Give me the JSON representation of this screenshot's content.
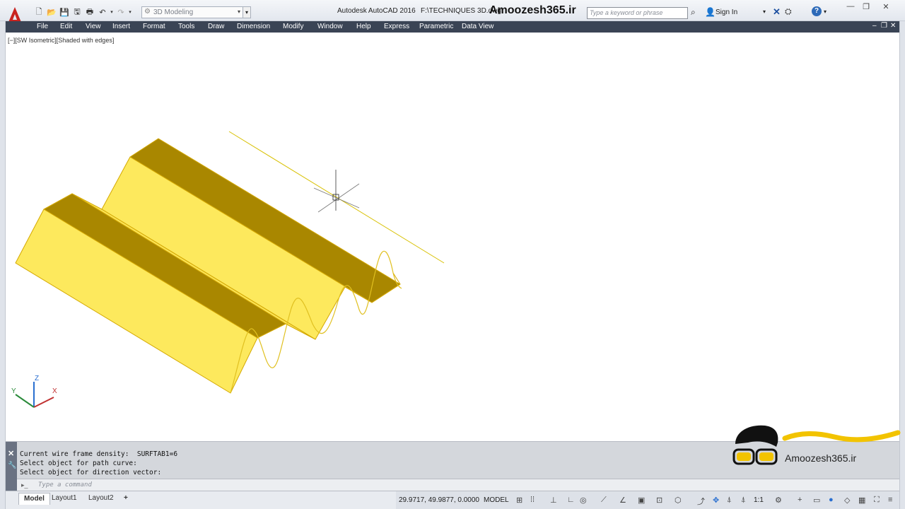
{
  "titlebar": {
    "app_title": "Autodesk AutoCAD 2016",
    "file_path": "F:\\TECHNIQUES 3D.dwg",
    "watermark": "Amoozesh365.ir",
    "workspace": "3D Modeling",
    "search_placeholder": "Type a keyword or phrase",
    "sign_in": "Sign In"
  },
  "menu": [
    "File",
    "Edit",
    "View",
    "Insert",
    "Format",
    "Tools",
    "Draw",
    "Dimension",
    "Modify",
    "Window",
    "Help",
    "Express",
    "Parametric",
    "Data View"
  ],
  "viewport": {
    "label": "[−][SW Isometric][Shaded with edges]",
    "axis_x": "X",
    "axis_y": "Y",
    "axis_z": "Z"
  },
  "command": {
    "history": [
      "Current wire frame density:  SURFTAB1=6",
      "Select object for path curve:",
      "Select object for direction vector:"
    ],
    "placeholder": "Type a command"
  },
  "logo": {
    "text": "Amoozesh365.ir"
  },
  "statusbar": {
    "tabs": [
      "Model",
      "Layout1",
      "Layout2"
    ],
    "add_tab": "+",
    "coordinates": "29.9717, 49.9877, 0.0000",
    "space": "MODEL",
    "scale": "1:1"
  },
  "colors": {
    "solid_top": "#fde95d",
    "solid_dark": "#a98700",
    "solid_edge": "#d4a800",
    "menubar": "#3a4455"
  }
}
